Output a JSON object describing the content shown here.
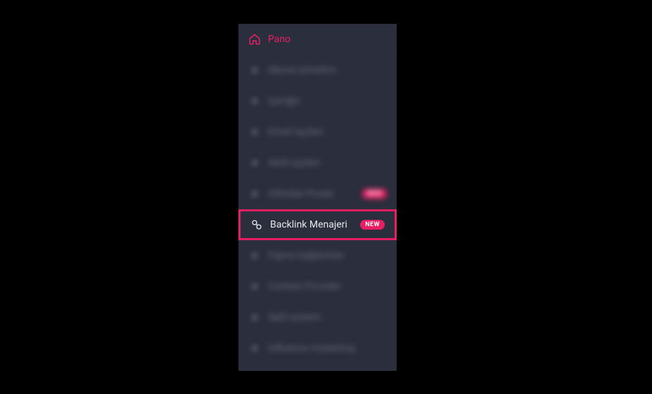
{
  "sidebar": {
    "items": [
      {
        "label": "Pano",
        "active": true,
        "icon": "home-icon",
        "blurred": false,
        "badge": null,
        "chev": false,
        "highlighted": false
      },
      {
        "label": "Abone yönetimi",
        "active": false,
        "icon": "dot-icon",
        "blurred": true,
        "badge": null,
        "chev": false,
        "highlighted": false
      },
      {
        "label": "Içeriğin",
        "active": false,
        "icon": "dot-icon",
        "blurred": true,
        "badge": null,
        "chev": true,
        "highlighted": false
      },
      {
        "label": "Email işçileri",
        "active": false,
        "icon": "dot-icon",
        "blurred": true,
        "badge": null,
        "chev": true,
        "highlighted": false
      },
      {
        "label": "Akıllı işçileri",
        "active": false,
        "icon": "dot-icon",
        "blurred": true,
        "badge": null,
        "chev": true,
        "highlighted": false
      },
      {
        "label": "Infinidat Poster",
        "active": false,
        "icon": "dot-icon",
        "blurred": true,
        "badge": "NEW",
        "chev": false,
        "highlighted": false
      },
      {
        "label": "Backlink Menajeri",
        "active": false,
        "icon": "link-icon",
        "blurred": false,
        "badge": "NEW",
        "chev": false,
        "highlighted": true
      },
      {
        "label": "Figma bağlantılar",
        "active": false,
        "icon": "dot-icon",
        "blurred": true,
        "badge": null,
        "chev": true,
        "highlighted": false
      },
      {
        "label": "Content Provider",
        "active": false,
        "icon": "dot-icon",
        "blurred": true,
        "badge": null,
        "chev": true,
        "highlighted": false
      },
      {
        "label": "Spill system",
        "active": false,
        "icon": "dot-icon",
        "blurred": true,
        "badge": null,
        "chev": false,
        "highlighted": false
      },
      {
        "label": "Influence marketing",
        "active": false,
        "icon": "dot-icon",
        "blurred": true,
        "badge": null,
        "chev": true,
        "highlighted": false
      }
    ]
  }
}
